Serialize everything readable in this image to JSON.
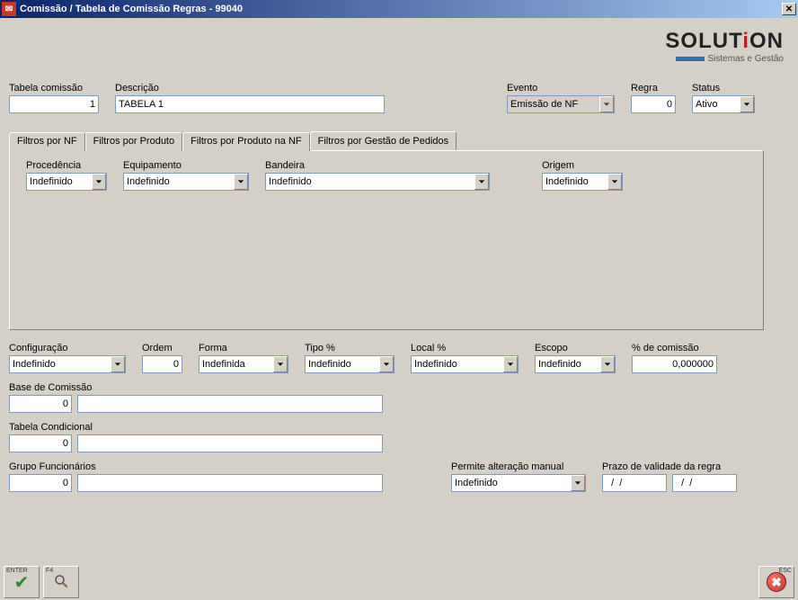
{
  "window": {
    "title": "Comissão / Tabela de Comissão Regras - 99040"
  },
  "logo": {
    "brand_before_i": "SOLUT",
    "brand_i": "i",
    "brand_after_i": "ON",
    "tagline": "Sistemas e Gestão"
  },
  "header": {
    "tabela_comissao": {
      "label": "Tabela comissão",
      "value": "1"
    },
    "descricao": {
      "label": "Descrição",
      "value": "TABELA 1"
    },
    "evento": {
      "label": "Evento",
      "value": "Emissão de NF"
    },
    "regra": {
      "label": "Regra",
      "value": "0"
    },
    "status": {
      "label": "Status",
      "value": "Ativo"
    }
  },
  "tabs": [
    {
      "label": "Filtros por NF",
      "active": false
    },
    {
      "label": "Filtros por Produto",
      "active": false
    },
    {
      "label": "Filtros por Produto na NF",
      "active": false
    },
    {
      "label": "Filtros por Gestão de Pedidos",
      "active": true
    }
  ],
  "tab_fields": {
    "procedencia": {
      "label": "Procedência",
      "value": "Indefinido"
    },
    "equipamento": {
      "label": "Equipamento",
      "value": "Indefinido"
    },
    "bandeira": {
      "label": "Bandeira",
      "value": "Indefinido"
    },
    "origem": {
      "label": "Origem",
      "value": "Indefinido"
    }
  },
  "config_row": {
    "configuracao": {
      "label": "Configuração",
      "value": "Indefinido"
    },
    "ordem": {
      "label": "Ordem",
      "value": "0"
    },
    "forma": {
      "label": "Forma",
      "value": "Indefinida"
    },
    "tipo_pct": {
      "label": "Tipo %",
      "value": "Indefinido"
    },
    "local_pct": {
      "label": "Local %",
      "value": "Indefinido"
    },
    "escopo": {
      "label": "Escopo",
      "value": "Indefinido"
    },
    "pct_comissao": {
      "label": "% de comissão",
      "value": "0,000000"
    }
  },
  "base_comissao": {
    "label": "Base de Comissão",
    "code": "0",
    "desc": ""
  },
  "tabela_condicional": {
    "label": "Tabela Condicional",
    "code": "0",
    "desc": ""
  },
  "grupo_funcionarios": {
    "label": "Grupo Funcionários",
    "code": "0",
    "desc": ""
  },
  "permite_alteracao": {
    "label": "Permite alteração manual",
    "value": "Indefinido"
  },
  "prazo_validade": {
    "label": "Prazo de validade da regra",
    "from": "  /  /",
    "to": "  /  /"
  },
  "buttons": {
    "enter": "ENTER",
    "f4": "F4",
    "esc": "ESC"
  }
}
